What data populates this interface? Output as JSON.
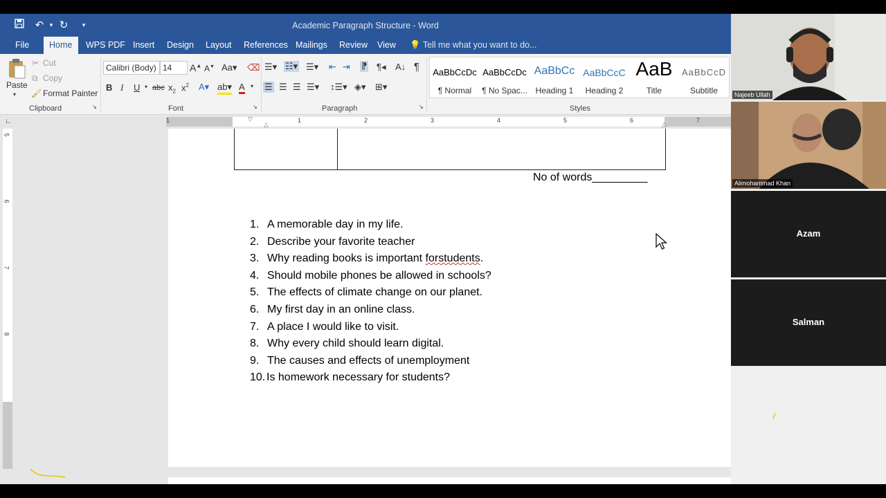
{
  "window": {
    "title": "Academic Paragraph Structure - Word"
  },
  "quick_access": {
    "save_icon": "save-icon",
    "undo_icon": "undo-icon",
    "redo_icon": "redo-icon",
    "customize_icon": "customize-icon"
  },
  "tabs": [
    {
      "label": "File"
    },
    {
      "label": "Home"
    },
    {
      "label": "WPS PDF"
    },
    {
      "label": "Insert"
    },
    {
      "label": "Design"
    },
    {
      "label": "Layout"
    },
    {
      "label": "References"
    },
    {
      "label": "Mailings"
    },
    {
      "label": "Review"
    },
    {
      "label": "View"
    }
  ],
  "tell_me": "Tell me what you want to do...",
  "clipboard": {
    "paste": "Paste",
    "cut": "Cut",
    "copy": "Copy",
    "format_painter": "Format Painter",
    "label": "Clipboard"
  },
  "font": {
    "family": "Calibri (Body)",
    "size": "14",
    "label": "Font"
  },
  "paragraph": {
    "label": "Paragraph"
  },
  "styles": {
    "label": "Styles",
    "items": [
      {
        "preview": "AaBbCcDc",
        "name": "¶ Normal"
      },
      {
        "preview": "AaBbCcDc",
        "name": "¶ No Spac..."
      },
      {
        "preview": "AaBbCc",
        "name": "Heading 1"
      },
      {
        "preview": "AaBbCcC",
        "name": "Heading 2"
      },
      {
        "preview": "AaB",
        "name": "Title"
      },
      {
        "preview": "AaBbCcD",
        "name": "Subtitle"
      }
    ]
  },
  "ruler": {
    "h_numbers": [
      "1",
      "1",
      "2",
      "3",
      "4",
      "5",
      "6",
      "7"
    ],
    "v_numbers": [
      "5",
      "6",
      "7",
      "8"
    ]
  },
  "document": {
    "word_count_line": "No of words_________",
    "topics": [
      {
        "num": "1.",
        "text": "A memorable day in my life."
      },
      {
        "num": "2.",
        "text": "Describe your favorite teacher"
      },
      {
        "num": "3.",
        "text_a": "Why reading books is important ",
        "text_b": "forstudents",
        "text_c": "."
      },
      {
        "num": "4.",
        "text": "Should mobile phones be allowed in schools?"
      },
      {
        "num": "5.",
        "text": "The effects of climate change on our planet."
      },
      {
        "num": "6.",
        "text": "My first day in an online class."
      },
      {
        "num": "7.",
        "text": "A place I would like to visit."
      },
      {
        "num": "8.",
        "text": "Why every child should learn digital."
      },
      {
        "num": "9.",
        "text": "The causes and effects of unemployment"
      },
      {
        "num": "10.",
        "text": "Is homework necessary for students?"
      }
    ]
  },
  "participants": [
    {
      "name": "Najeeb Ullah"
    },
    {
      "name": "Alimohammad Khan"
    },
    {
      "name": "Azam"
    },
    {
      "name": "Salman"
    }
  ]
}
